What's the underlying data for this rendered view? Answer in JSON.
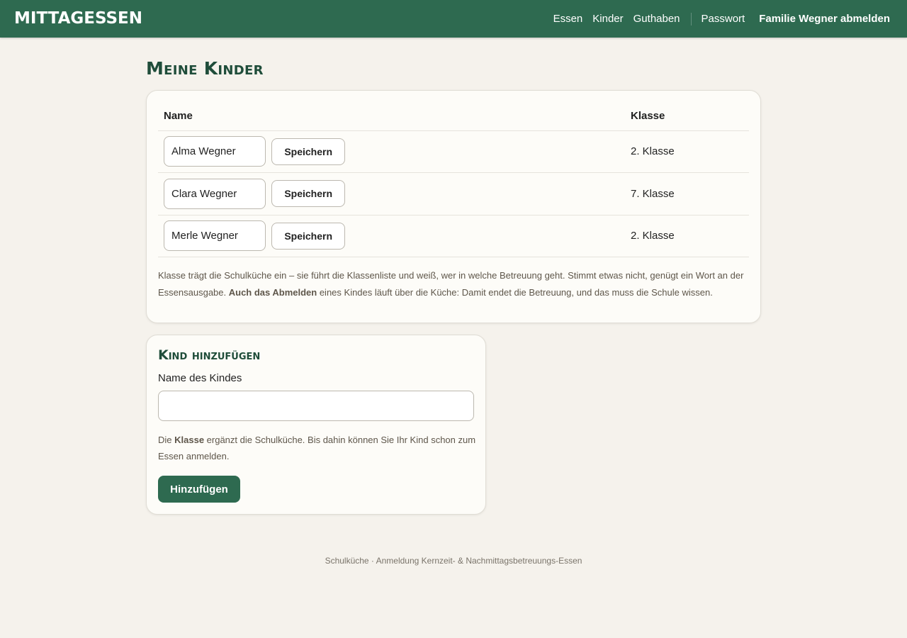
{
  "header": {
    "brand": "Mittagessen",
    "nav": {
      "essen": "Essen",
      "kinder": "Kinder",
      "guthaben": "Guthaben",
      "passwort": "Passwort",
      "logout": "Familie Wegner abmelden"
    }
  },
  "page": {
    "title": "Meine Kinder"
  },
  "kids_table": {
    "headers": {
      "name": "Name",
      "klasse": "Klasse"
    },
    "save_label": "Speichern",
    "rows": [
      {
        "name": "Alma Wegner",
        "klasse": "2. Klasse"
      },
      {
        "name": "Clara Wegner",
        "klasse": "7. Klasse"
      },
      {
        "name": "Merle Wegner",
        "klasse": "2. Klasse"
      }
    ],
    "note": {
      "part1": "Klasse trägt die Schulküche ein – sie führt die Klassenliste und weiß, wer in welche Betreuung geht. Stimmt etwas nicht, genügt ein Wort an der Essensausgabe. ",
      "bold": "Auch das Abmelden",
      "part2": " eines Kindes läuft über die Küche: Damit endet die Betreuung, und das muss die Schule wissen."
    }
  },
  "add_child": {
    "title": "Kind hinzufügen",
    "field_label": "Name des Kindes",
    "field_value": "",
    "note": {
      "part1": "Die ",
      "bold": "Klasse",
      "part2": " ergänzt die Schulküche. Bis dahin können Sie Ihr Kind schon zum Essen anmelden."
    },
    "button_label": "Hinzufügen"
  },
  "footer": {
    "text": "Schulküche · Anmeldung Kernzeit- & Nachmittagsbetreuungs-Essen"
  },
  "colors": {
    "accent": "#2e6a50",
    "heading": "#1f4d3a",
    "background": "#f5f2ec"
  }
}
